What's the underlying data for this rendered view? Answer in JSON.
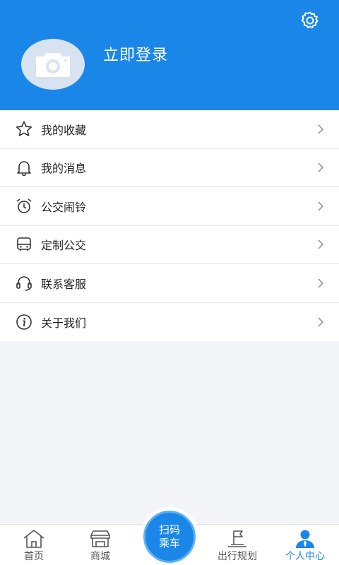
{
  "header": {
    "login_label": "立即登录",
    "accent_color": "#1a87e8",
    "avatar_icon": "camera-icon",
    "settings_icon": "gear-icon"
  },
  "menu": {
    "items": [
      {
        "label": "我的收藏",
        "icon": "star-icon"
      },
      {
        "label": "我的消息",
        "icon": "bell-icon"
      },
      {
        "label": "公交闹铃",
        "icon": "alarm-clock-icon"
      },
      {
        "label": "定制公交",
        "icon": "bus-icon"
      },
      {
        "label": "联系客服",
        "icon": "headset-icon"
      },
      {
        "label": "关于我们",
        "icon": "info-icon"
      }
    ]
  },
  "tabbar": {
    "tabs": [
      {
        "label": "首页",
        "icon": "home-icon",
        "active": false
      },
      {
        "label": "商城",
        "icon": "shop-icon",
        "active": false
      },
      {
        "label": "出行规划",
        "icon": "route-flag-icon",
        "active": false
      },
      {
        "label": "个人中心",
        "icon": "user-icon",
        "active": true
      }
    ],
    "scan": {
      "line1": "扫码",
      "line2": "乘车"
    }
  }
}
